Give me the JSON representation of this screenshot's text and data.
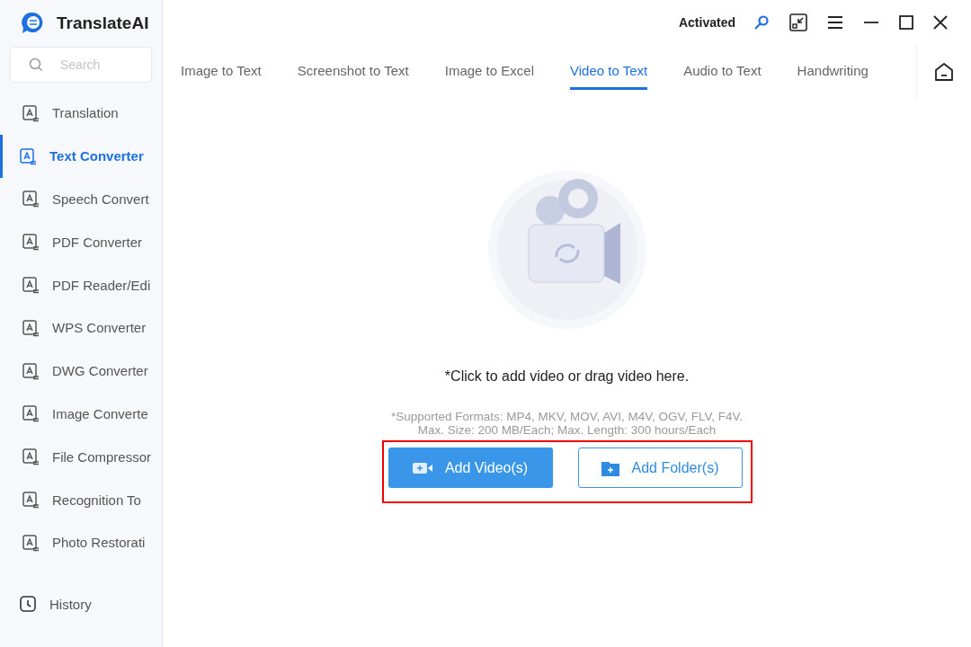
{
  "app": {
    "name": "TranslateAI"
  },
  "search": {
    "placeholder": "Search"
  },
  "sidebar": {
    "items": [
      {
        "label": "Translation",
        "selected": false
      },
      {
        "label": "Text Converter",
        "selected": true
      },
      {
        "label": "Speech Convert",
        "selected": false
      },
      {
        "label": "PDF Converter",
        "selected": false
      },
      {
        "label": "PDF Reader/Edi",
        "selected": false
      },
      {
        "label": "WPS Converter",
        "selected": false
      },
      {
        "label": "DWG Converter",
        "selected": false
      },
      {
        "label": "Image Converte",
        "selected": false
      },
      {
        "label": "File Compressor",
        "selected": false
      },
      {
        "label": "Recognition To",
        "selected": false
      },
      {
        "label": "Photo Restorati",
        "selected": false
      }
    ],
    "history": "History"
  },
  "title_bar": {
    "status": "Activated"
  },
  "tabs": [
    {
      "label": "Image to Text",
      "selected": false
    },
    {
      "label": "Screenshot to Text",
      "selected": false
    },
    {
      "label": "Image to Excel",
      "selected": false
    },
    {
      "label": "Video to Text",
      "selected": true
    },
    {
      "label": "Audio to Text",
      "selected": false
    },
    {
      "label": "Handwriting",
      "selected": false
    }
  ],
  "drop_zone": {
    "prompt": "*Click to add video or drag video here.",
    "formats": "*Supported Formats: MP4, MKV, MOV, AVI, M4V, OGV, FLV, F4V.",
    "limits": "Max. Size: 200 MB/Each; Max. Length: 300 hours/Each",
    "buttons": [
      {
        "label": "Add Video(s)",
        "kind": "primary"
      },
      {
        "label": "Add Folder(s)",
        "kind": "outline"
      }
    ]
  }
}
